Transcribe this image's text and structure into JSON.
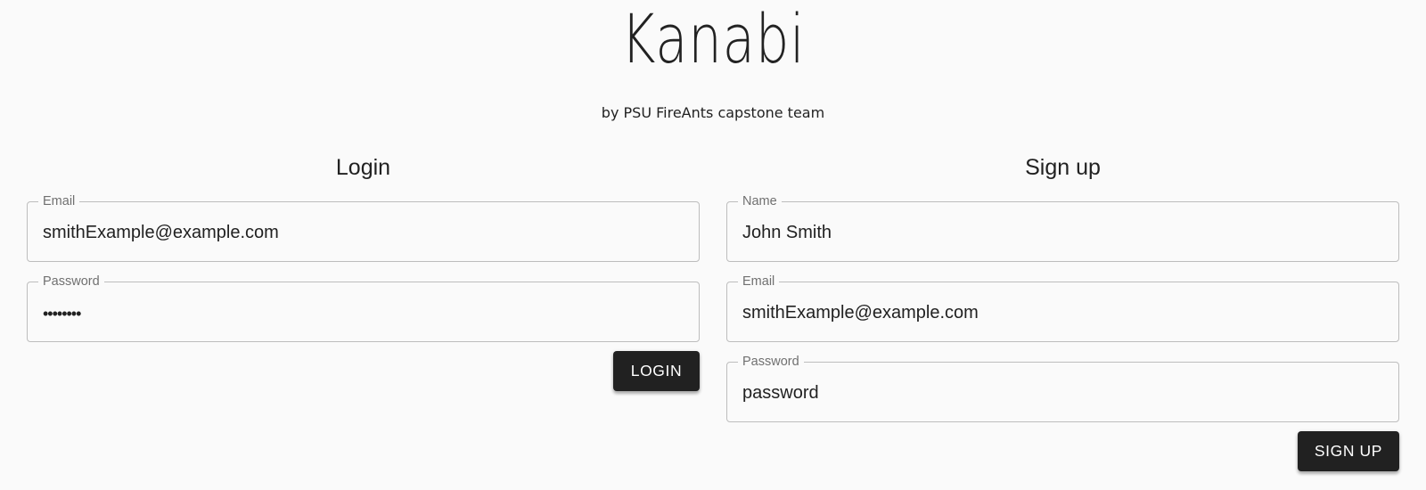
{
  "brand": {
    "title": "Kanabi",
    "subtitle": "by PSU FireAnts capstone team"
  },
  "login": {
    "heading": "Login",
    "email": {
      "label": "Email",
      "value": "smithExample@example.com"
    },
    "password": {
      "label": "Password",
      "value": "••••••••"
    },
    "button_label": "LOGIN"
  },
  "signup": {
    "heading": "Sign up",
    "name": {
      "label": "Name",
      "value": "John Smith"
    },
    "email": {
      "label": "Email",
      "value": "smithExample@example.com"
    },
    "password": {
      "label": "Password",
      "value": "password"
    },
    "button_label": "SIGN UP"
  }
}
